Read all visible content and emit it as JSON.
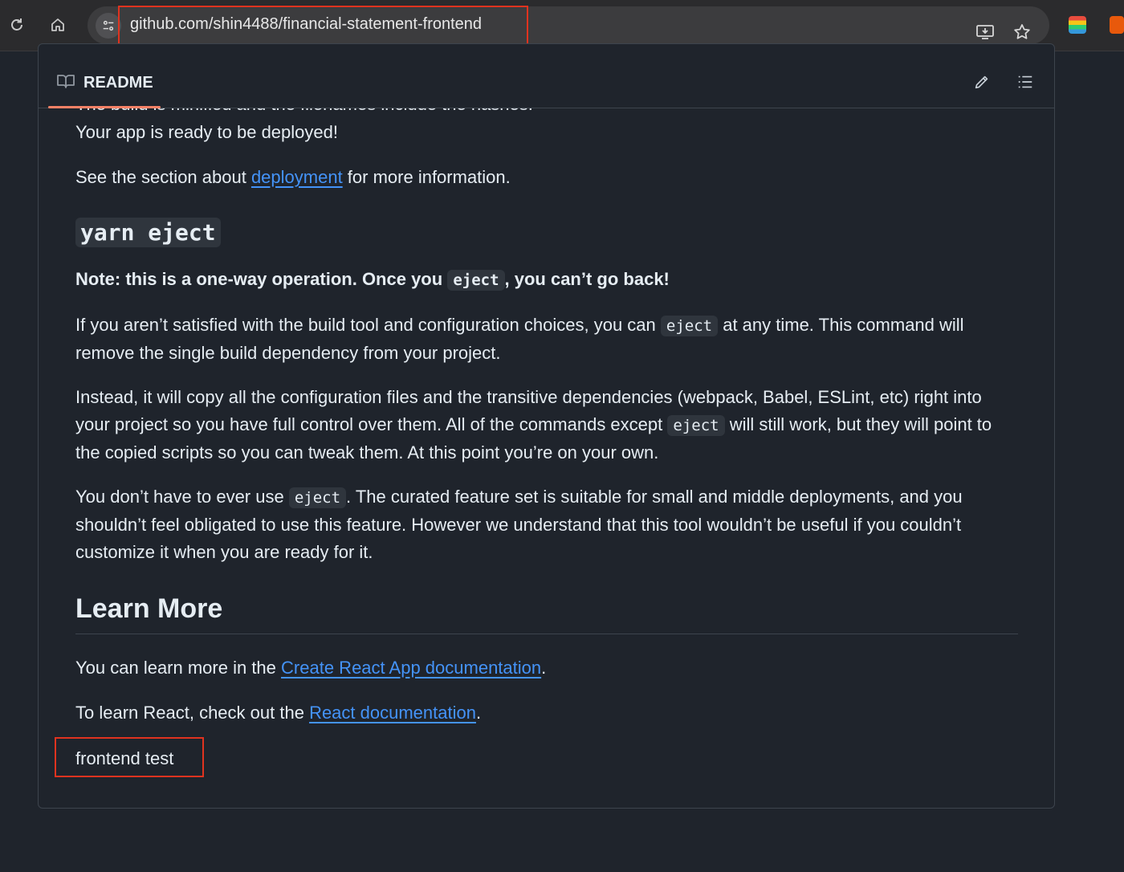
{
  "browser": {
    "url": "github.com/shin4488/financial-statement-frontend",
    "icons": [
      "reload-icon",
      "home-icon",
      "site-info-icon",
      "install-icon",
      "star-icon"
    ],
    "extension_colors": [
      "#f5c518",
      "#e8590c"
    ]
  },
  "readme": {
    "tab_label": "README",
    "cut_line": "The build is minified and the filenames include the hashes.",
    "ready": "Your app is ready to be deployed!",
    "see_section_pre": "See the section about ",
    "see_section_link": "deployment",
    "see_section_post": " for more information.",
    "eject_heading": "yarn eject",
    "note_pre": "Note: this is a one-way operation. Once you ",
    "note_code": "eject",
    "note_post": ", you can’t go back!",
    "p1_pre": "If you aren’t satisfied with the build tool and configuration choices, you can ",
    "p1_code": "eject",
    "p1_post": " at any time. This command will remove the single build dependency from your project.",
    "p2_pre": "Instead, it will copy all the configuration files and the transitive dependencies (webpack, Babel, ESLint, etc) right into your project so you have full control over them. All of the commands except ",
    "p2_code": "eject",
    "p2_post": " will still work, but they will point to the copied scripts so you can tweak them. At this point you’re on your own.",
    "p3_pre": "You don’t have to ever use ",
    "p3_code": "eject",
    "p3_post": ". The curated feature set is suitable for small and middle deployments, and you shouldn’t feel obligated to use this feature. However we understand that this tool wouldn’t be useful if you couldn’t customize it when you are ready for it.",
    "learn_more": "Learn More",
    "learn_pre": "You can learn more in the ",
    "learn_link": "Create React App documentation",
    "learn_post": ".",
    "react_pre": "To learn React, check out the ",
    "react_link": "React documentation",
    "react_post": ".",
    "frontend_test": "frontend test"
  },
  "colors": {
    "link": "#4493f8",
    "highlight_box": "#e0331f",
    "tab_underline": "#f78166"
  }
}
